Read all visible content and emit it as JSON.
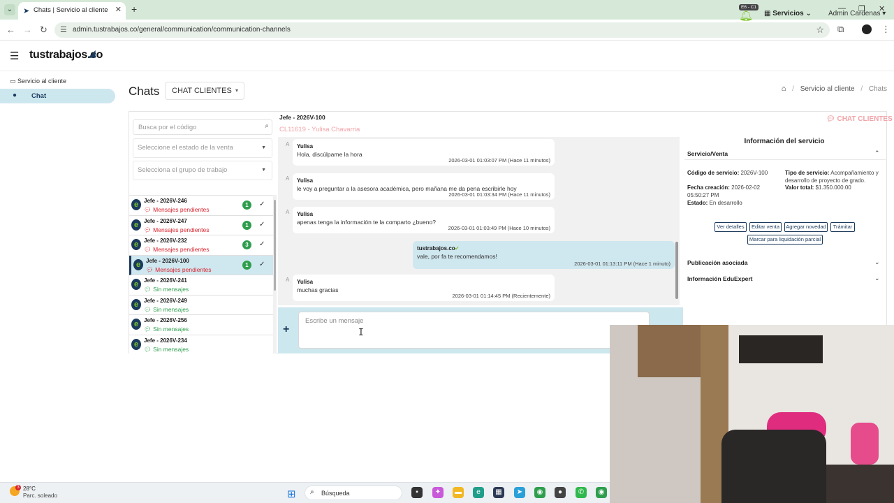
{
  "browser": {
    "tab_title": "Chats | Servicio al cliente",
    "url": "admin.tustrabajos.co/general/communication/communication-channels"
  },
  "header": {
    "logo": "tustrabajos.co",
    "bell_badge": "E6 - C1",
    "services": "Servicios",
    "user": "Admin Cardenas"
  },
  "sidebar": {
    "section": "Servicio al cliente",
    "items": [
      {
        "label": "Chat"
      }
    ]
  },
  "page": {
    "title": "Chats",
    "channel": "CHAT CLIENTES",
    "breadcrumb": [
      "Servicio al cliente",
      "Chats"
    ]
  },
  "filters": {
    "search_placeholder": "Busca por el código",
    "status_placeholder": "Seleccione el estado de la venta",
    "group_placeholder": "Selecciona el grupo de trabajo"
  },
  "chats": [
    {
      "title": "Jefe - 2026V-246",
      "status": "Mensajes pendientes",
      "count": "1",
      "pending": true
    },
    {
      "title": "Jefe - 2026V-247",
      "status": "Mensajes pendientes",
      "count": "1",
      "pending": true
    },
    {
      "title": "Jefe - 2026V-232",
      "status": "Mensajes pendientes",
      "count": "3",
      "pending": true
    },
    {
      "title": "Jefe - 2026V-100",
      "status": "Mensajes pendientes",
      "count": "1",
      "pending": true
    },
    {
      "title": "Jefe - 2026V-241",
      "status": "Sin mensajes",
      "pending": false
    },
    {
      "title": "Jefe - 2026V-249",
      "status": "Sin mensajes",
      "pending": false
    },
    {
      "title": "Jefe - 2026V-256",
      "status": "Sin mensajes",
      "pending": false
    },
    {
      "title": "Jefe - 2026V-234",
      "status": "Sin mensajes",
      "pending": false
    }
  ],
  "conversation": {
    "title": "Jefe - 2026V-100",
    "client": "CL11619 - Yulisa Chavarria",
    "channel_tag": "CHAT CLIENTES",
    "messages": [
      {
        "avatar": "A",
        "sender": "Yulisa",
        "text": "Hola, discúlpame la hora",
        "time": "2026-03-01 01:03:07 PM (Hace 11 minutos)"
      },
      {
        "avatar": "A",
        "sender": "Yulisa",
        "text": "le voy a preguntar a la asesora académica, pero mañana me da pena escribirle hoy",
        "time": "2026-03-01 01:03:34 PM (Hace 11 minutos)"
      },
      {
        "avatar": "A",
        "sender": "Yulisa",
        "text": "apenas tenga la información te la comparto ¿bueno?",
        "time": "2026-03-01 01:03:49 PM (Hace 10 minutos)"
      },
      {
        "avatar": "",
        "sender": "tustrabajos.co",
        "text": "vale, por fa te recomendamos!",
        "time": "2026-03-01 01:13:11 PM (Hace 1 minuto)"
      },
      {
        "avatar": "A",
        "sender": "Yulisa",
        "text": "muchas gracias",
        "time": "2026-03-01 01:14:45 PM (Recientemente)"
      }
    ],
    "input_placeholder": "Escribe un mensaje"
  },
  "info": {
    "title": "Información del servicio",
    "section_service": "Servicio/Venta",
    "codigo_label": "Código de servicio:",
    "codigo": "2026V-100",
    "tipo_label": "Tipo de servicio:",
    "tipo": "Acompañamiento y desarrollo de proyecto de grado.",
    "fecha_label": "Fecha creación:",
    "fecha": "2026-02-02 05:50:27 PM",
    "valor_label": "Valor total:",
    "valor": "$1.350.000.00",
    "estado_label": "Estado:",
    "estado": "En desarrollo",
    "buttons": [
      "Ver detalles",
      "Editar venta",
      "Agregar novedad",
      "Trámitar",
      "Marcar para liquidación parcial"
    ],
    "section_pub": "Publicación asociada",
    "section_edu": "Información EduExpert"
  },
  "taskbar": {
    "temp": "28°C",
    "weather": "Parc. soleado",
    "weather_badge": "3",
    "search": "Búsqueda"
  },
  "colors": {
    "brand": "#1b3a5c",
    "accent_green": "#7dc42a",
    "pending_red": "#d9232d",
    "highlight": "#cfe7ef"
  }
}
